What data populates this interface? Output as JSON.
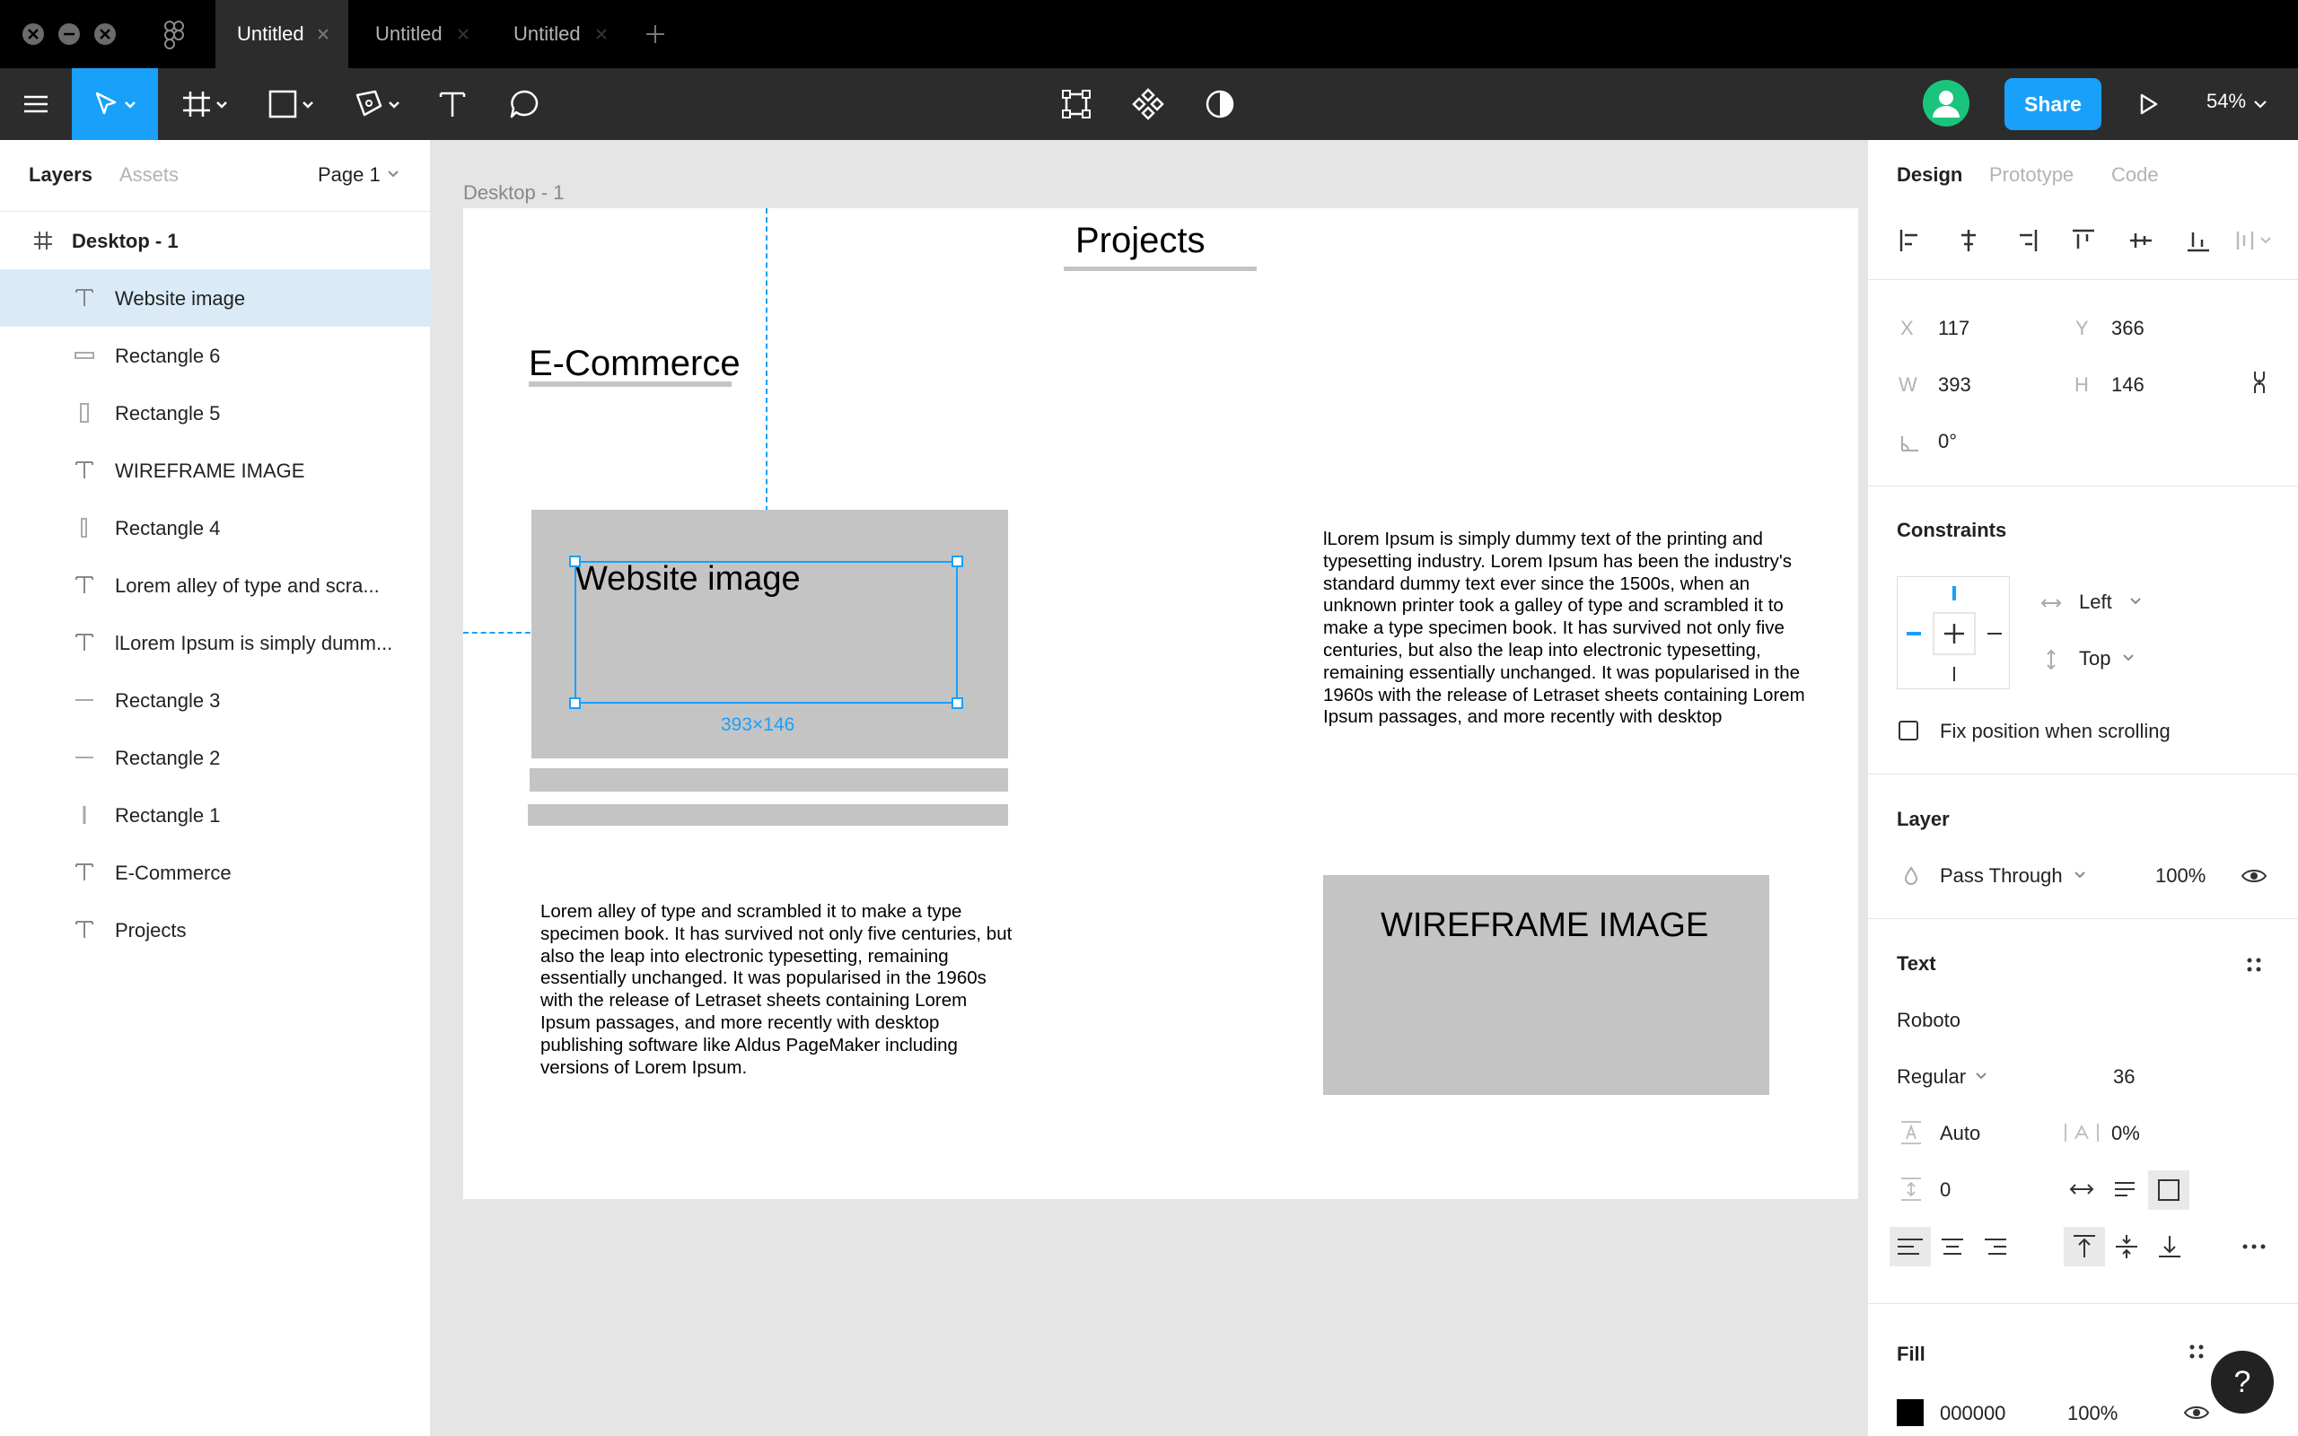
{
  "tabs": [
    {
      "label": "Untitled",
      "active": true
    },
    {
      "label": "Untitled",
      "active": false
    },
    {
      "label": "Untitled",
      "active": false
    }
  ],
  "toolbar": {
    "share_label": "Share",
    "zoom": "54%"
  },
  "left_panel": {
    "tabs": [
      "Layers",
      "Assets"
    ],
    "page": "Page 1",
    "frame": "Desktop - 1",
    "layers": [
      {
        "label": "Website image",
        "icon": "text-icon",
        "selected": true
      },
      {
        "label": "Rectangle 6",
        "icon": "rectangle-icon"
      },
      {
        "label": "Rectangle 5",
        "icon": "rectangle-icon"
      },
      {
        "label": "WIREFRAME IMAGE",
        "icon": "text-icon"
      },
      {
        "label": "Rectangle 4",
        "icon": "rectangle-icon"
      },
      {
        "label": "Lorem alley of type and scra...",
        "icon": "text-icon"
      },
      {
        "label": "lLorem Ipsum is simply dumm...",
        "icon": "text-icon"
      },
      {
        "label": "Rectangle 3",
        "icon": "line-icon"
      },
      {
        "label": "Rectangle 2",
        "icon": "line-icon"
      },
      {
        "label": "Rectangle 1",
        "icon": "rectangle-icon"
      },
      {
        "label": "E-Commerce",
        "icon": "text-icon"
      },
      {
        "label": "Projects",
        "icon": "text-icon"
      }
    ]
  },
  "canvas": {
    "frame_label": "Desktop - 1",
    "projects": "Projects",
    "ecommerce": "E-Commerce",
    "website_image": "Website image",
    "selection_size": "393×146",
    "wireframe": "WIREFRAME IMAGE",
    "lorem_right": "lLorem Ipsum is simply dummy text of the printing and typesetting industry. Lorem Ipsum has been the industry's standard dummy text ever since the 1500s, when an unknown printer took a galley of type and scrambled it to make a type specimen book. It has survived not only five centuries, but also the leap into electronic typesetting, remaining essentially unchanged. It was popularised in the 1960s with the release of Letraset sheets containing Lorem Ipsum passages, and more recently with desktop",
    "lorem_left": "Lorem alley of type and scrambled it to make a type specimen book. It has survived not only five centuries, but also the leap into electronic typesetting, remaining essentially unchanged. It was popularised in the 1960s with the release of Letraset sheets containing Lorem Ipsum passages, and more recently with desktop publishing software like Aldus PageMaker including versions of Lorem Ipsum."
  },
  "right_panel": {
    "tabs": [
      "Design",
      "Prototype",
      "Code"
    ],
    "x_label": "X",
    "x": "117",
    "y_label": "Y",
    "y": "366",
    "w_label": "W",
    "w": "393",
    "h_label": "H",
    "h": "146",
    "rotation": "0°",
    "constraints_title": "Constraints",
    "constraint_h": "Left",
    "constraint_v": "Top",
    "fix_position": "Fix position when scrolling",
    "layer_title": "Layer",
    "blend": "Pass Through",
    "opacity": "100%",
    "text_title": "Text",
    "font_family": "Roboto",
    "font_weight": "Regular",
    "font_size": "36",
    "line_height": "Auto",
    "letter_spacing": "0%",
    "paragraph_spacing": "0",
    "fill_title": "Fill",
    "fill_hex": "000000",
    "fill_opacity": "100%"
  },
  "colors": {
    "accent": "#18a0fb",
    "selection_bg": "#daebf7",
    "toolbar_bg": "#2c2c2c"
  },
  "help": "?"
}
